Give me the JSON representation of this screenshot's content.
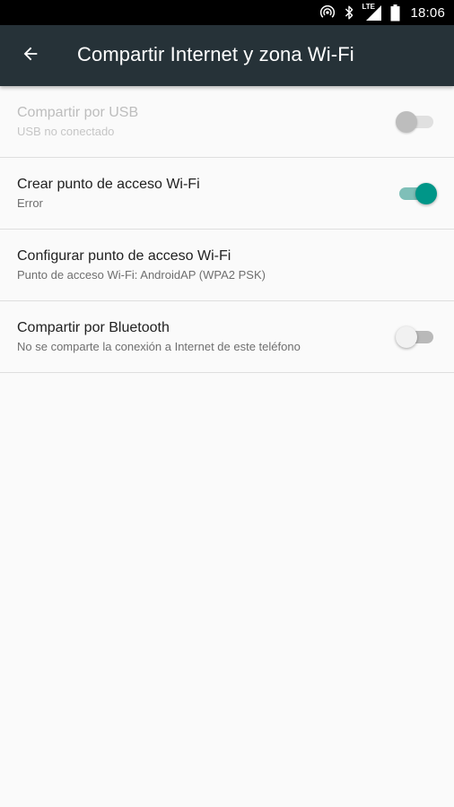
{
  "status_bar": {
    "icons": [
      "hotspot-icon",
      "bluetooth-icon",
      "lte-signal-icon",
      "battery-icon"
    ],
    "network_label": "LTE",
    "time": "18:06"
  },
  "toolbar": {
    "back_icon": "arrow-back-icon",
    "title": "Compartir Internet y zona Wi-Fi"
  },
  "colors": {
    "toolbar": "#263238",
    "accent": "#009688",
    "background": "#fafafa"
  },
  "preferences": [
    {
      "title": "Compartir por USB",
      "summary": "USB no conectado",
      "enabled": false,
      "switch": "off"
    },
    {
      "title": "Crear punto de acceso Wi-Fi",
      "summary": "Error",
      "enabled": true,
      "switch": "on"
    },
    {
      "title": "Configurar punto de acceso Wi-Fi",
      "summary": "Punto de acceso Wi-Fi: AndroidAP (WPA2 PSK)",
      "enabled": true,
      "switch": null
    },
    {
      "title": "Compartir por Bluetooth",
      "summary": "No se comparte la conexión a Internet de este teléfono",
      "enabled": true,
      "switch": "off"
    }
  ]
}
